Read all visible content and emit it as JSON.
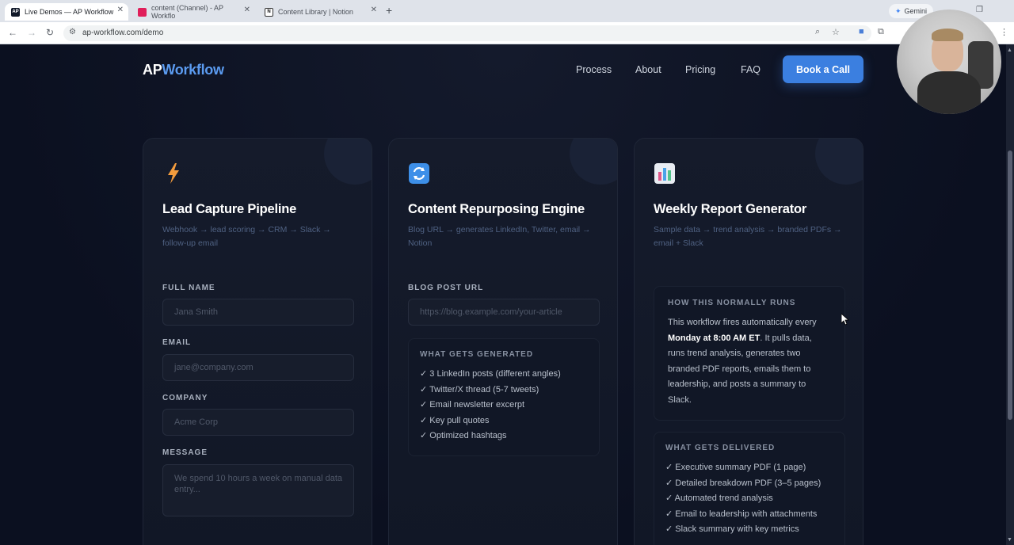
{
  "browser": {
    "tabs": [
      {
        "title": "Live Demos — AP Workflow",
        "favicon": "AP"
      },
      {
        "title": "content (Channel) - AP Workflo",
        "favicon": "slack-icon"
      },
      {
        "title": "Content Library | Notion",
        "favicon": "notion-icon"
      }
    ],
    "gemini_label": "Gemini",
    "url": "ap-workflow.com/demo"
  },
  "site": {
    "logo_ap": "AP",
    "logo_workflow": "Workflow",
    "nav": {
      "process": "Process",
      "about": "About",
      "pricing": "Pricing",
      "faq": "FAQ"
    },
    "cta": "Book a Call"
  },
  "cards": {
    "lead": {
      "icon": "lightning-icon",
      "title": "Lead Capture Pipeline",
      "subtitle": "Webhook → lead scoring → CRM → Slack → follow-up email",
      "full_name_label": "FULL NAME",
      "full_name_placeholder": "Jana Smith",
      "email_label": "EMAIL",
      "email_placeholder": "jane@company.com",
      "company_label": "COMPANY",
      "company_placeholder": "Acme Corp",
      "message_label": "MESSAGE",
      "message_placeholder": "We spend 10 hours a week on manual data entry..."
    },
    "content": {
      "icon": "repeat-icon",
      "title": "Content Repurposing Engine",
      "subtitle": "Blog URL → generates LinkedIn, Twitter, email → Notion",
      "blog_label": "BLOG POST URL",
      "blog_placeholder": "https://blog.example.com/your-article",
      "generated_title": "WHAT GETS GENERATED",
      "generated_items": [
        "✓ 3 LinkedIn posts (different angles)",
        "✓ Twitter/X thread (5-7 tweets)",
        "✓ Email newsletter excerpt",
        "✓ Key pull quotes",
        "✓ Optimized hashtags"
      ]
    },
    "report": {
      "icon": "bar-chart-icon",
      "title": "Weekly Report Generator",
      "subtitle": "Sample data → trend analysis → branded PDFs → email + Slack",
      "normal_title": "HOW THIS NORMALLY RUNS",
      "normal_pre": "This workflow fires automatically every ",
      "normal_bold": "Monday at 8:00 AM ET",
      "normal_post": ". It pulls data, runs trend analysis, generates two branded PDF reports, emails them to leadership, and posts a summary to Slack.",
      "delivered_title": "WHAT GETS DELIVERED",
      "delivered_items": [
        "✓ Executive summary PDF (1 page)",
        "✓ Detailed breakdown PDF (3–5 pages)",
        "✓ Automated trend analysis",
        "✓ Email to leadership with attachments",
        "✓ Slack summary with key metrics"
      ]
    }
  }
}
